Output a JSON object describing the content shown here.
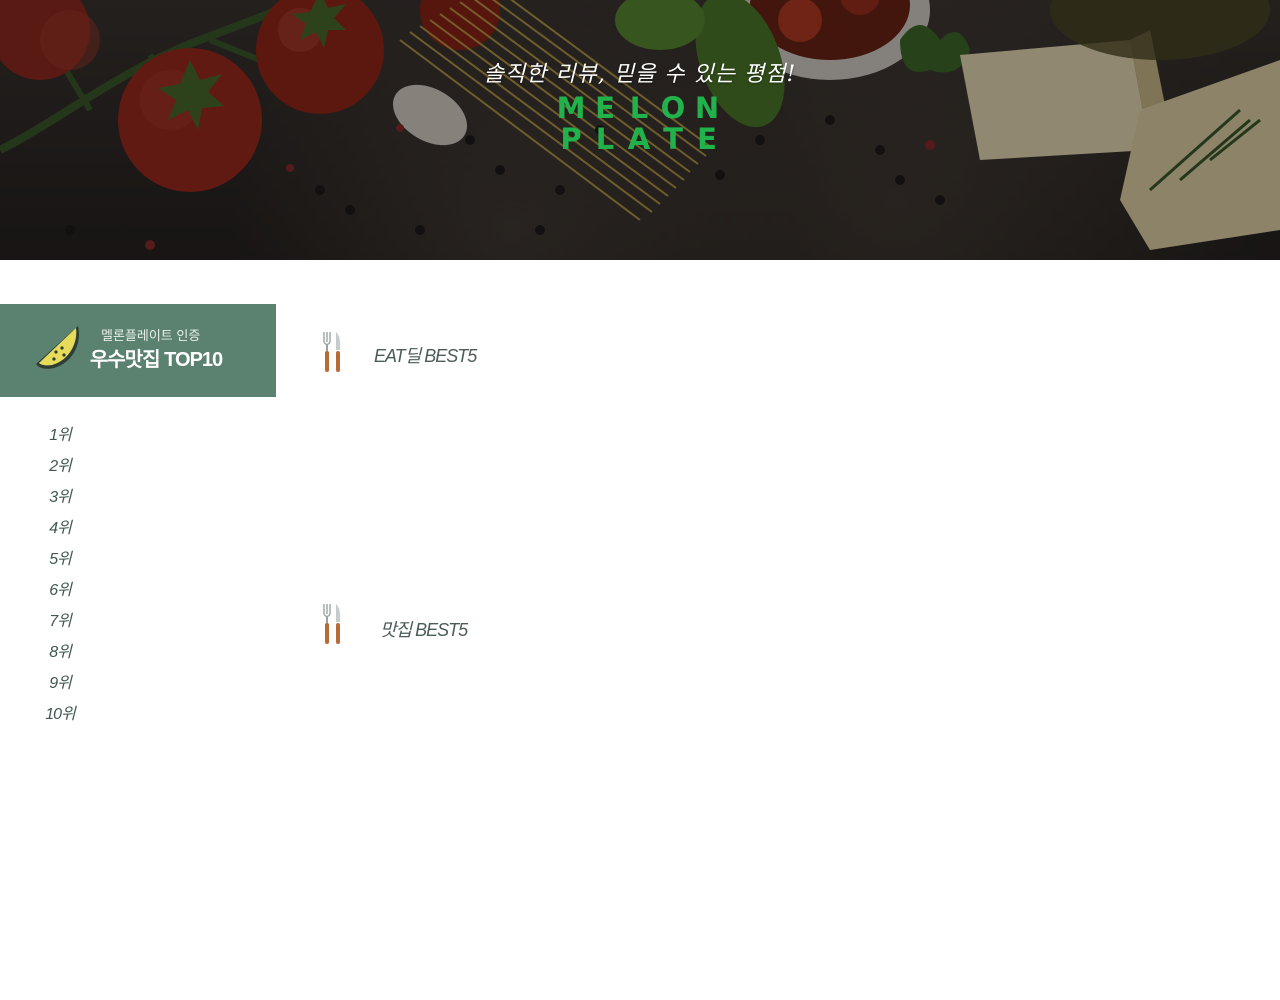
{
  "hero": {
    "tagline": "솔직한 리뷰, 믿을 수 있는 평점!",
    "logo_letters_row1": [
      "M",
      "E",
      "L",
      "O",
      "N"
    ],
    "logo_letters_row2": [
      "P",
      "L",
      "A",
      "T",
      "E"
    ],
    "logo_color": "#22b24c"
  },
  "sidebar": {
    "header_color": "#5b8271",
    "icon": "melon-icon",
    "subtitle": "멜론플레이트 인증",
    "title": "우수맛집 TOP10",
    "ranks": [
      "1위",
      "2위",
      "3위",
      "4위",
      "5위",
      "6위",
      "7위",
      "8위",
      "9위",
      "10위"
    ]
  },
  "sections": [
    {
      "icon": "fork-knife-icon",
      "title": "EAT딜 BEST5"
    },
    {
      "icon": "fork-knife-icon",
      "title": "맛집 BEST5"
    }
  ]
}
